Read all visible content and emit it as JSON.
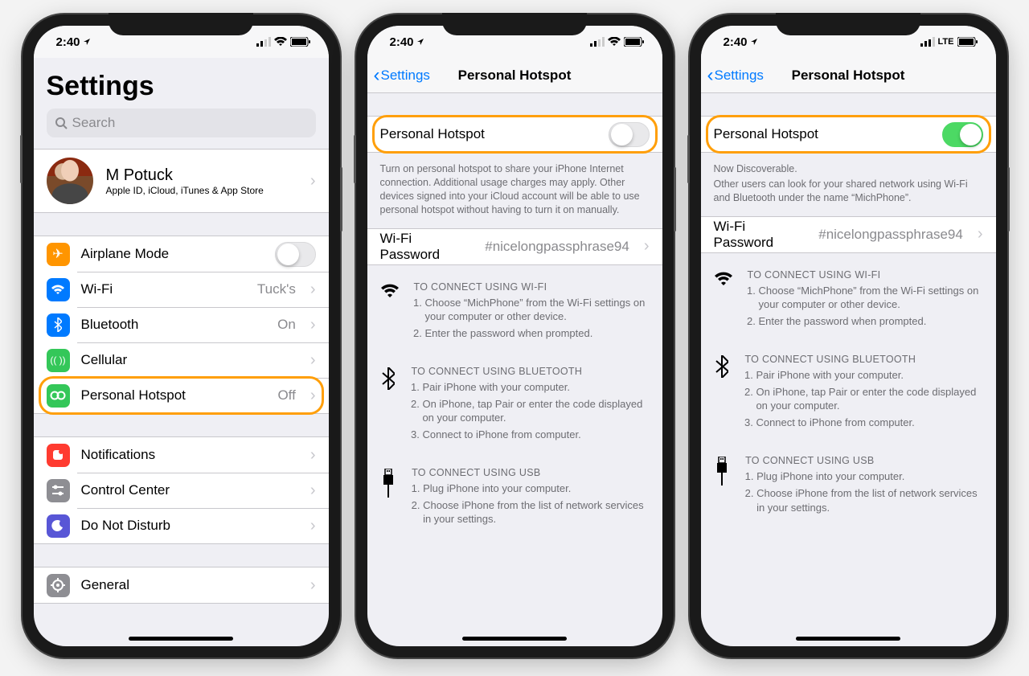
{
  "status": {
    "time": "2:40",
    "carrier_mode_3": "LTE"
  },
  "screen1": {
    "title": "Settings",
    "search_placeholder": "Search",
    "apple_id": {
      "name": "M Potuck",
      "sub": "Apple ID, iCloud, iTunes & App Store"
    },
    "rows": {
      "airplane": "Airplane Mode",
      "wifi": "Wi-Fi",
      "wifi_value": "Tuck's",
      "bluetooth": "Bluetooth",
      "bluetooth_value": "On",
      "cellular": "Cellular",
      "hotspot": "Personal Hotspot",
      "hotspot_value": "Off",
      "notifications": "Notifications",
      "control_center": "Control Center",
      "dnd": "Do Not Disturb",
      "general": "General"
    }
  },
  "screen2": {
    "back": "Settings",
    "title": "Personal Hotspot",
    "toggle_label": "Personal Hotspot",
    "footer_off": "Turn on personal hotspot to share your iPhone Internet connection. Additional usage charges may apply. Other devices signed into your iCloud account will be able to use personal hotspot without having to turn it on manually.",
    "footer_on1": "Now Discoverable.",
    "footer_on2": "Other users can look for your shared network using Wi-Fi and Bluetooth under the name “MichPhone”.",
    "wifi_pwd_label": "Wi-Fi Password",
    "wifi_pwd_value": "#nicelongpassphrase94",
    "wifi_h": "TO CONNECT USING WI-FI",
    "wifi_1": "Choose “MichPhone” from the Wi-Fi settings on your computer or other device.",
    "wifi_2": "Enter the password when prompted.",
    "bt_h": "TO CONNECT USING BLUETOOTH",
    "bt_1": "Pair iPhone with your computer.",
    "bt_2": "On iPhone, tap Pair or enter the code displayed on your computer.",
    "bt_3": "Connect to iPhone from computer.",
    "usb_h": "TO CONNECT USING USB",
    "usb_1": "Plug iPhone into your computer.",
    "usb_2": "Choose iPhone from the list of network services in your settings."
  },
  "colors": {
    "airplane": "#ff9500",
    "wifi": "#007aff",
    "bluetooth": "#007aff",
    "cellular": "#34c759",
    "hotspot": "#34c759",
    "notifications": "#ff3b30",
    "control": "#8e8e93",
    "dnd": "#5856d6",
    "general": "#8e8e93"
  }
}
